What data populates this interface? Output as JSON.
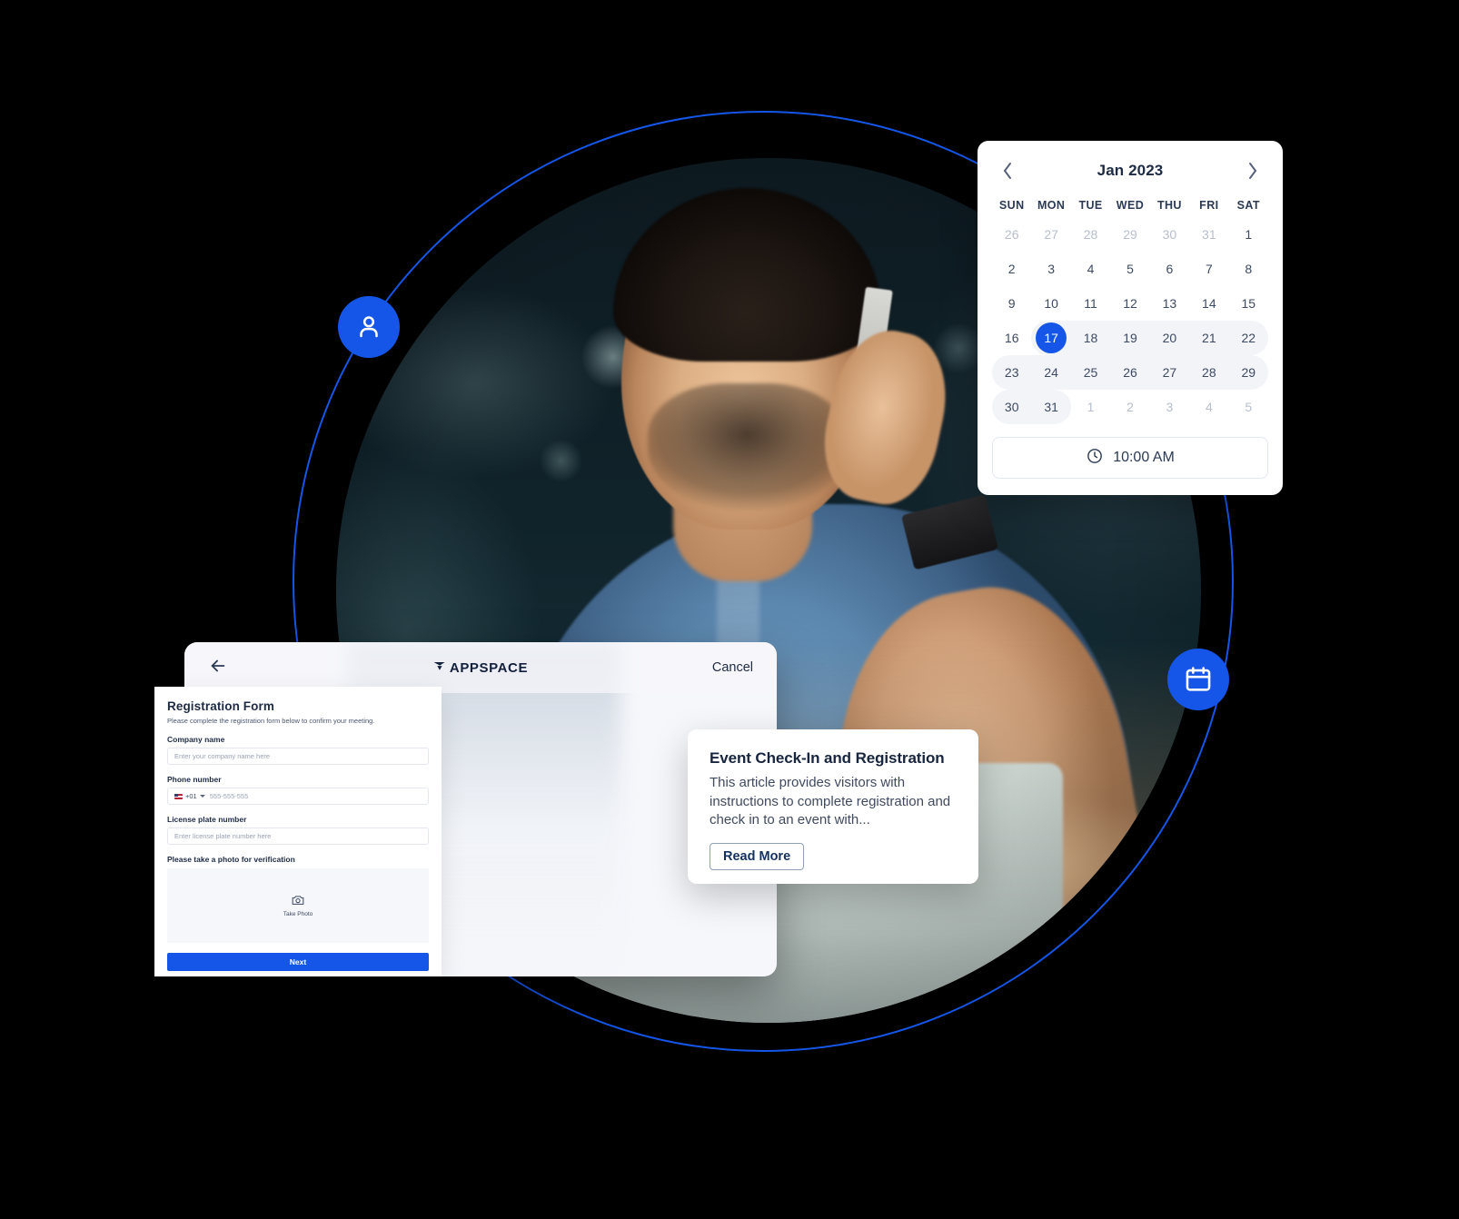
{
  "theme": {
    "accent": "#1556e8",
    "background": "#000000",
    "card_bg": "#ffffff",
    "kiosk_bg": "#f6f7fb",
    "text_dark": "#1d2b45",
    "text_muted": "#b7bfcc",
    "range_bg": "#f2f4f8"
  },
  "badges": {
    "person": "person-icon",
    "calendar": "calendar-icon"
  },
  "calendar": {
    "prev_label": "‹",
    "next_label": "›",
    "title": "Jan 2023",
    "weekdays": [
      "SUN",
      "MON",
      "TUE",
      "WED",
      "THU",
      "FRI",
      "SAT"
    ],
    "weeks": [
      [
        {
          "d": "26",
          "muted": true
        },
        {
          "d": "27",
          "muted": true
        },
        {
          "d": "28",
          "muted": true
        },
        {
          "d": "29",
          "muted": true
        },
        {
          "d": "30",
          "muted": true
        },
        {
          "d": "31",
          "muted": true
        },
        {
          "d": "1",
          "muted": false
        }
      ],
      [
        {
          "d": "2"
        },
        {
          "d": "3"
        },
        {
          "d": "4"
        },
        {
          "d": "5"
        },
        {
          "d": "6"
        },
        {
          "d": "7"
        },
        {
          "d": "8"
        }
      ],
      [
        {
          "d": "9"
        },
        {
          "d": "10"
        },
        {
          "d": "11"
        },
        {
          "d": "12"
        },
        {
          "d": "13"
        },
        {
          "d": "14"
        },
        {
          "d": "15"
        }
      ],
      [
        {
          "d": "16"
        },
        {
          "d": "17",
          "selected": true,
          "inrange": true,
          "range_start": true
        },
        {
          "d": "18",
          "inrange": true
        },
        {
          "d": "19",
          "inrange": true
        },
        {
          "d": "20",
          "inrange": true
        },
        {
          "d": "21",
          "inrange": true
        },
        {
          "d": "22",
          "inrange": true,
          "range_end": true
        }
      ],
      [
        {
          "d": "23",
          "inrange": true,
          "range_start": true
        },
        {
          "d": "24",
          "inrange": true
        },
        {
          "d": "25",
          "inrange": true
        },
        {
          "d": "26",
          "inrange": true
        },
        {
          "d": "27",
          "inrange": true
        },
        {
          "d": "28",
          "inrange": true
        },
        {
          "d": "29",
          "inrange": true,
          "range_end": true
        }
      ],
      [
        {
          "d": "30",
          "inrange": true,
          "range_start": true
        },
        {
          "d": "31",
          "inrange": true,
          "range_end": true
        },
        {
          "d": "1",
          "muted": true
        },
        {
          "d": "2",
          "muted": true
        },
        {
          "d": "3",
          "muted": true
        },
        {
          "d": "4",
          "muted": true
        },
        {
          "d": "5",
          "muted": true
        }
      ]
    ],
    "time": {
      "icon": "clock-icon",
      "value": "10:00 AM"
    }
  },
  "kiosk": {
    "back_icon": "arrow-left-icon",
    "logo_text": "APPSPACE",
    "cancel_label": "Cancel",
    "form": {
      "title": "Registration Form",
      "subtitle": "Please complete the  registration form below to confirm your meeting.",
      "fields": [
        {
          "label": "Company name",
          "placeholder": "Enter your company name here",
          "type": "text"
        },
        {
          "label": "Phone number",
          "country_code": "+01",
          "placeholder": "555-555-555",
          "type": "phone"
        },
        {
          "label": "License plate number",
          "placeholder": "Enter license plate number here",
          "type": "text"
        }
      ],
      "photo_label": "Please take a photo for verification",
      "photo_icon": "camera-icon",
      "photo_action": "Take Photo",
      "submit_label": "Next"
    }
  },
  "article": {
    "title": "Event Check-In and Registration",
    "body": "This article provides visitors with instructions to complete registration and check in to an event with...",
    "button_label": "Read More"
  }
}
